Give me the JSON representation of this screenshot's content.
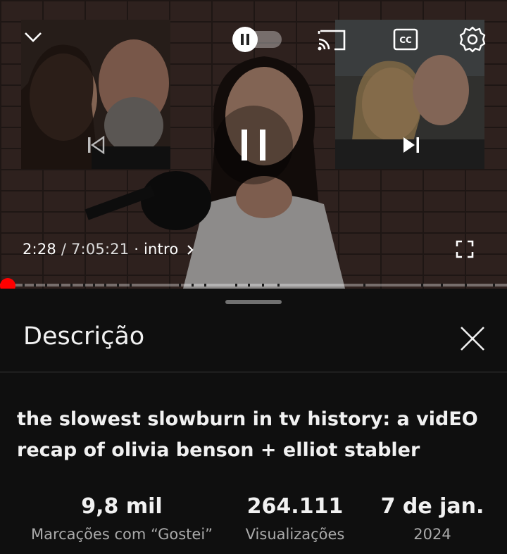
{
  "player": {
    "current_time": "2:28",
    "separator": " / ",
    "duration": "7:05:21",
    "chapter": " · intro",
    "progress_fraction": 0.015,
    "icons": {
      "collapse": "chevron-down-icon",
      "autoplay": "autoplay-toggle-icon",
      "cast": "cast-icon",
      "captions": "closed-captions-icon",
      "settings": "gear-icon",
      "previous": "skip-previous-icon",
      "pause": "pause-icon",
      "next": "skip-next-icon",
      "fullscreen": "fullscreen-icon",
      "chapter_chevron": "chevron-right-icon"
    },
    "accent_color": "#ff0000"
  },
  "description_sheet": {
    "heading": "Descrição",
    "video_title": "the slowest slowburn in tv history: a vidEO recap of olivia benson + elliot stabler",
    "stats": [
      {
        "value": "9,8 mil",
        "label": "Marcações com “Gostei”"
      },
      {
        "value": "264.111",
        "label": "Visualizações"
      },
      {
        "value": "7 de jan.",
        "label": "2024"
      }
    ]
  }
}
